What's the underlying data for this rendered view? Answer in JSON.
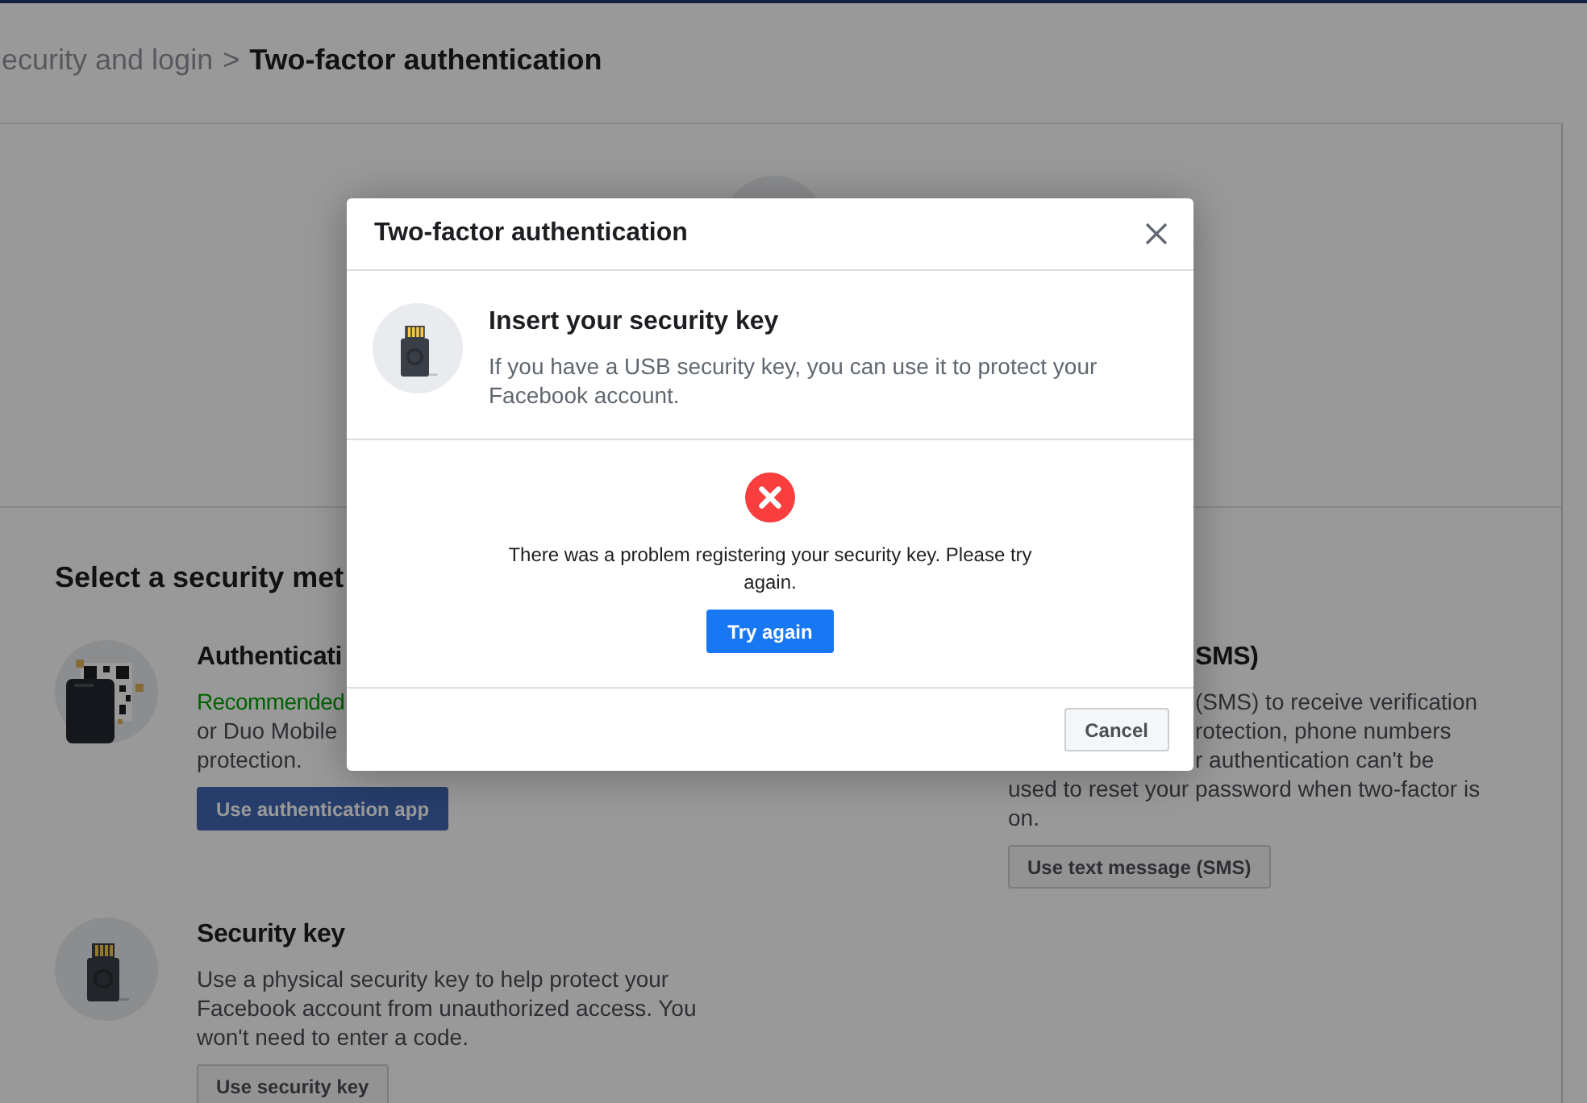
{
  "breadcrumb": {
    "parent": "ecurity and login",
    "separator": ">",
    "current": "Two-factor authentication"
  },
  "section_title": "Select a security met",
  "methods": [
    {
      "kind": "app",
      "title": "Authenticati",
      "lines": [
        {
          "text": "Recommended",
          "kind": "highlight"
        },
        {
          "text": "or Duo Mobile",
          "kind": "plain"
        },
        {
          "text": "protection.",
          "kind": "plain"
        }
      ],
      "button": {
        "label": "Use authentication app",
        "primary": true
      }
    },
    {
      "kind": "sms",
      "title": "SMS)",
      "covered_lines": [
        "(SMS) to receive verification",
        "rotection, phone numbers",
        "r authentication can't be"
      ],
      "lines": [
        {
          "text": "used to reset your password when two-factor is",
          "kind": "plain"
        },
        {
          "text": "on.",
          "kind": "plain"
        }
      ],
      "button": {
        "label": "Use text message (SMS)",
        "primary": false
      }
    },
    {
      "kind": "key",
      "title": "Security key",
      "lines": [
        {
          "text": "Use a physical security key to help protect your Facebook account from unauthorized access. You won't need to enter a code.",
          "kind": "plain"
        }
      ],
      "button": {
        "label": "Use security key",
        "primary": false
      }
    }
  ],
  "dialog": {
    "title": "Two-factor authentication",
    "heading": "Insert your security key",
    "description": "If you have a USB security key, you can use it to protect your Facebook account.",
    "error": "There was a problem registering your security key. Please try again.",
    "action": {
      "label": "Try again",
      "primary": true
    },
    "cancel": {
      "label": "Cancel",
      "primary": false
    }
  }
}
